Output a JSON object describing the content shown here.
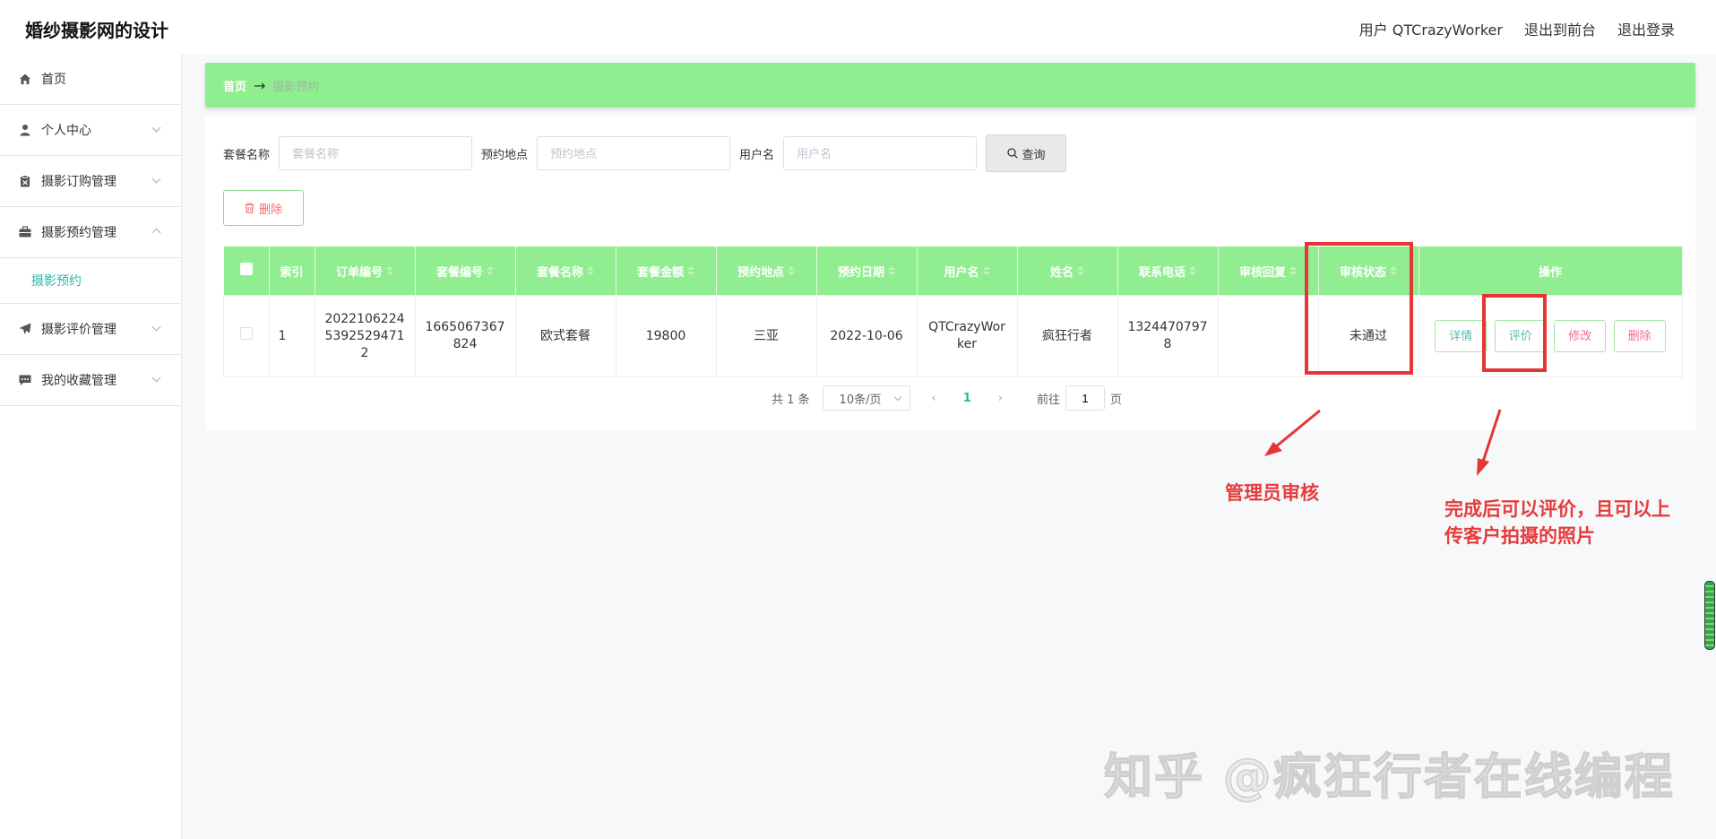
{
  "app": {
    "title": "婚纱摄影网的设计",
    "user_label": "用户 QTCrazyWorker",
    "front_link": "退出到前台",
    "logout": "退出登录"
  },
  "sidebar": {
    "items": [
      {
        "label": "首页",
        "icon": "home-icon"
      },
      {
        "label": "个人中心",
        "icon": "user-icon"
      },
      {
        "label": "摄影订购管理",
        "icon": "clipboard-icon"
      },
      {
        "label": "摄影预约管理",
        "icon": "briefcase-icon",
        "expanded": true
      },
      {
        "label": "摄影评价管理",
        "icon": "send-icon"
      },
      {
        "label": "我的收藏管理",
        "icon": "message-icon"
      }
    ],
    "active_sub": "摄影预约"
  },
  "breadcrumb": {
    "home": "首页",
    "arrow": "→",
    "current": "摄影预约"
  },
  "search": {
    "package_label": "套餐名称",
    "package_placeholder": "套餐名称",
    "location_label": "预约地点",
    "location_placeholder": "预约地点",
    "username_label": "用户名",
    "username_placeholder": "用户名",
    "query_button": "查询"
  },
  "delete_button": "删除",
  "table": {
    "headers": [
      "索引",
      "订单编号",
      "套餐编号",
      "套餐名称",
      "套餐金额",
      "预约地点",
      "预约日期",
      "用户名",
      "姓名",
      "联系电话",
      "审核回复",
      "审核状态",
      "操作"
    ],
    "rows": [
      {
        "index": "1",
        "order_no_1": "2022106224",
        "order_no_2": "5392529471",
        "order_no_3": "2",
        "package_no_1": "1665067367",
        "package_no_2": "824",
        "package_name": "欧式套餐",
        "amount": "19800",
        "location": "三亚",
        "date": "2022-10-06",
        "username_1": "QTCrazyWor",
        "username_2": "ker",
        "name": "疯狂行者",
        "phone_1": "1324470797",
        "phone_2": "8",
        "reply": "",
        "status": "未通过",
        "actions": {
          "detail": "详情",
          "review": "评价",
          "edit": "修改",
          "delete": "删除"
        }
      }
    ]
  },
  "pagination": {
    "total": "共 1 条",
    "page_size": "10条/页",
    "prev": "‹",
    "current": "1",
    "next": "›",
    "goto_label": "前往",
    "goto_value": "1",
    "goto_suffix": "页"
  },
  "annotations": {
    "admin_review": "管理员审核",
    "after_done_1": "完成后可以评价，且可以上",
    "after_done_2": "传客户拍摄的照片",
    "color": "#e53535"
  },
  "watermark": "知乎 @疯狂行者在线编程",
  "colors": {
    "header_green": "#90ee90",
    "accent_teal": "#2ab7a9",
    "danger": "#f56c6c"
  }
}
